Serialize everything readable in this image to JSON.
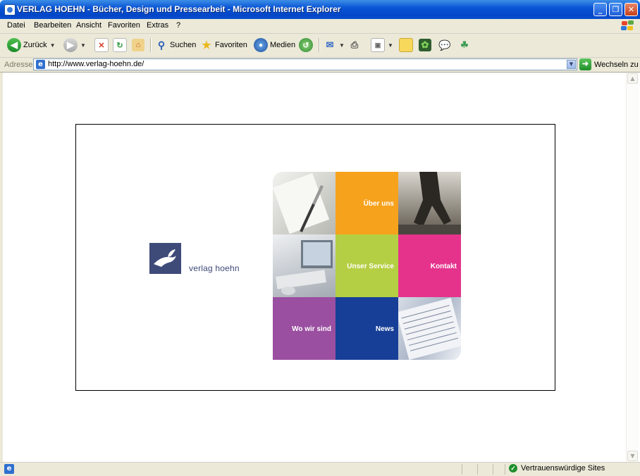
{
  "window": {
    "title": "VERLAG HOEHN - Bücher, Design und Pressearbeit - Microsoft Internet Explorer",
    "minimize_label": "_",
    "maximize_label": "❐",
    "close_label": "✕"
  },
  "menubar": {
    "items": [
      "Datei",
      "Bearbeiten",
      "Ansicht",
      "Favoriten",
      "Extras",
      "?"
    ]
  },
  "toolbar": {
    "back_label": "Zurück",
    "search_label": "Suchen",
    "favorites_label": "Favoriten",
    "media_label": "Medien"
  },
  "addressbar": {
    "label": "Adresse",
    "url": "http://www.verlag-hoehn.de/",
    "go_label": "Wechseln zu"
  },
  "page": {
    "logo_text": "verlag hoehn",
    "tiles": {
      "ueber_uns": "Über uns",
      "unser_service": "Unser Service",
      "kontakt": "Kontakt",
      "wo_wir_sind": "Wo wir sind",
      "news": "News"
    },
    "colors": {
      "ueber_uns": "#f6a21d",
      "unser_service": "#b4cf43",
      "kontakt": "#e5338c",
      "wo_wir_sind": "#9a4fa0",
      "news": "#173f97",
      "logo": "#3e4a78"
    }
  },
  "statusbar": {
    "zone_label": "Vertrauenswürdige Sites"
  },
  "icons": [
    "ie-page-icon",
    "back-arrow-icon",
    "forward-arrow-icon",
    "stop-icon",
    "refresh-icon",
    "home-icon",
    "search-icon",
    "favorites-star-icon",
    "media-icon",
    "history-icon",
    "mail-icon",
    "print-icon",
    "edit-icon",
    "notes-icon",
    "messenger-icon",
    "discuss-icon",
    "research-icon",
    "go-arrow-icon",
    "trusted-sites-icon",
    "windows-logo-icon"
  ]
}
